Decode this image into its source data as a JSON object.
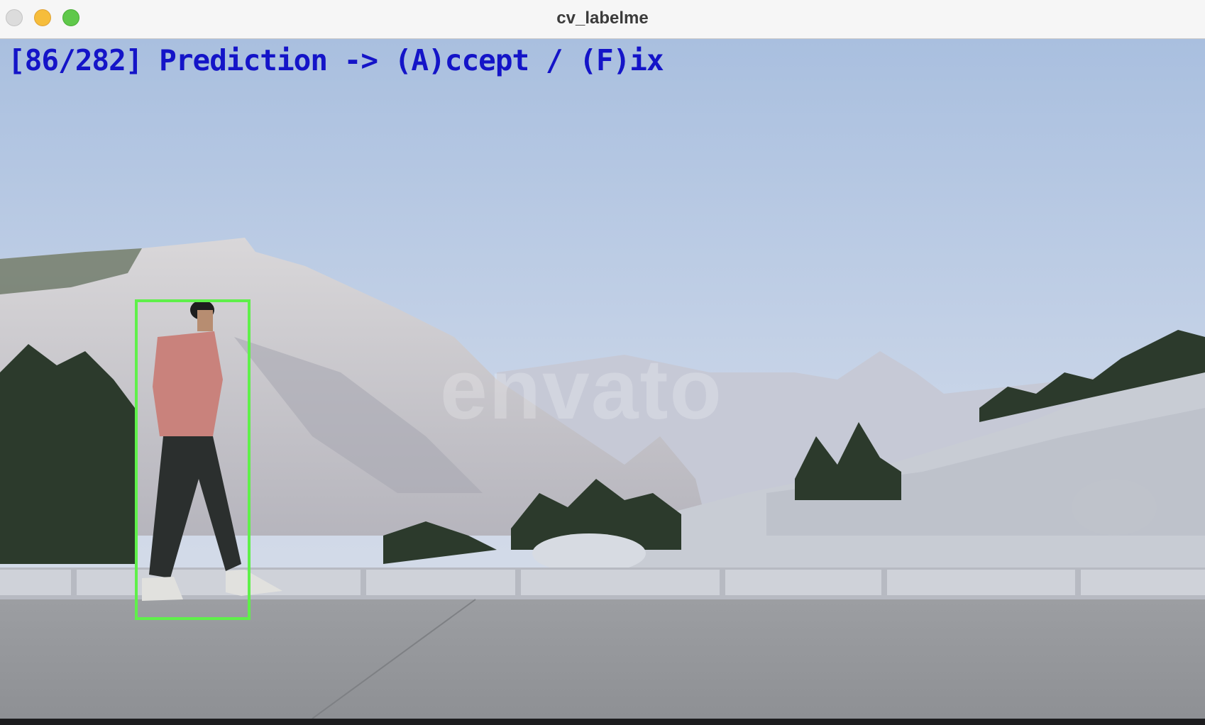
{
  "window": {
    "title": "cv_labelme"
  },
  "annotation": {
    "status_text": "[86/282] Prediction -> (A)ccept / (F)ix",
    "bbox_color": "#5ff04a",
    "text_color": "#1414c8"
  },
  "image": {
    "watermark": "envato",
    "description_icon": "photo-scene"
  }
}
